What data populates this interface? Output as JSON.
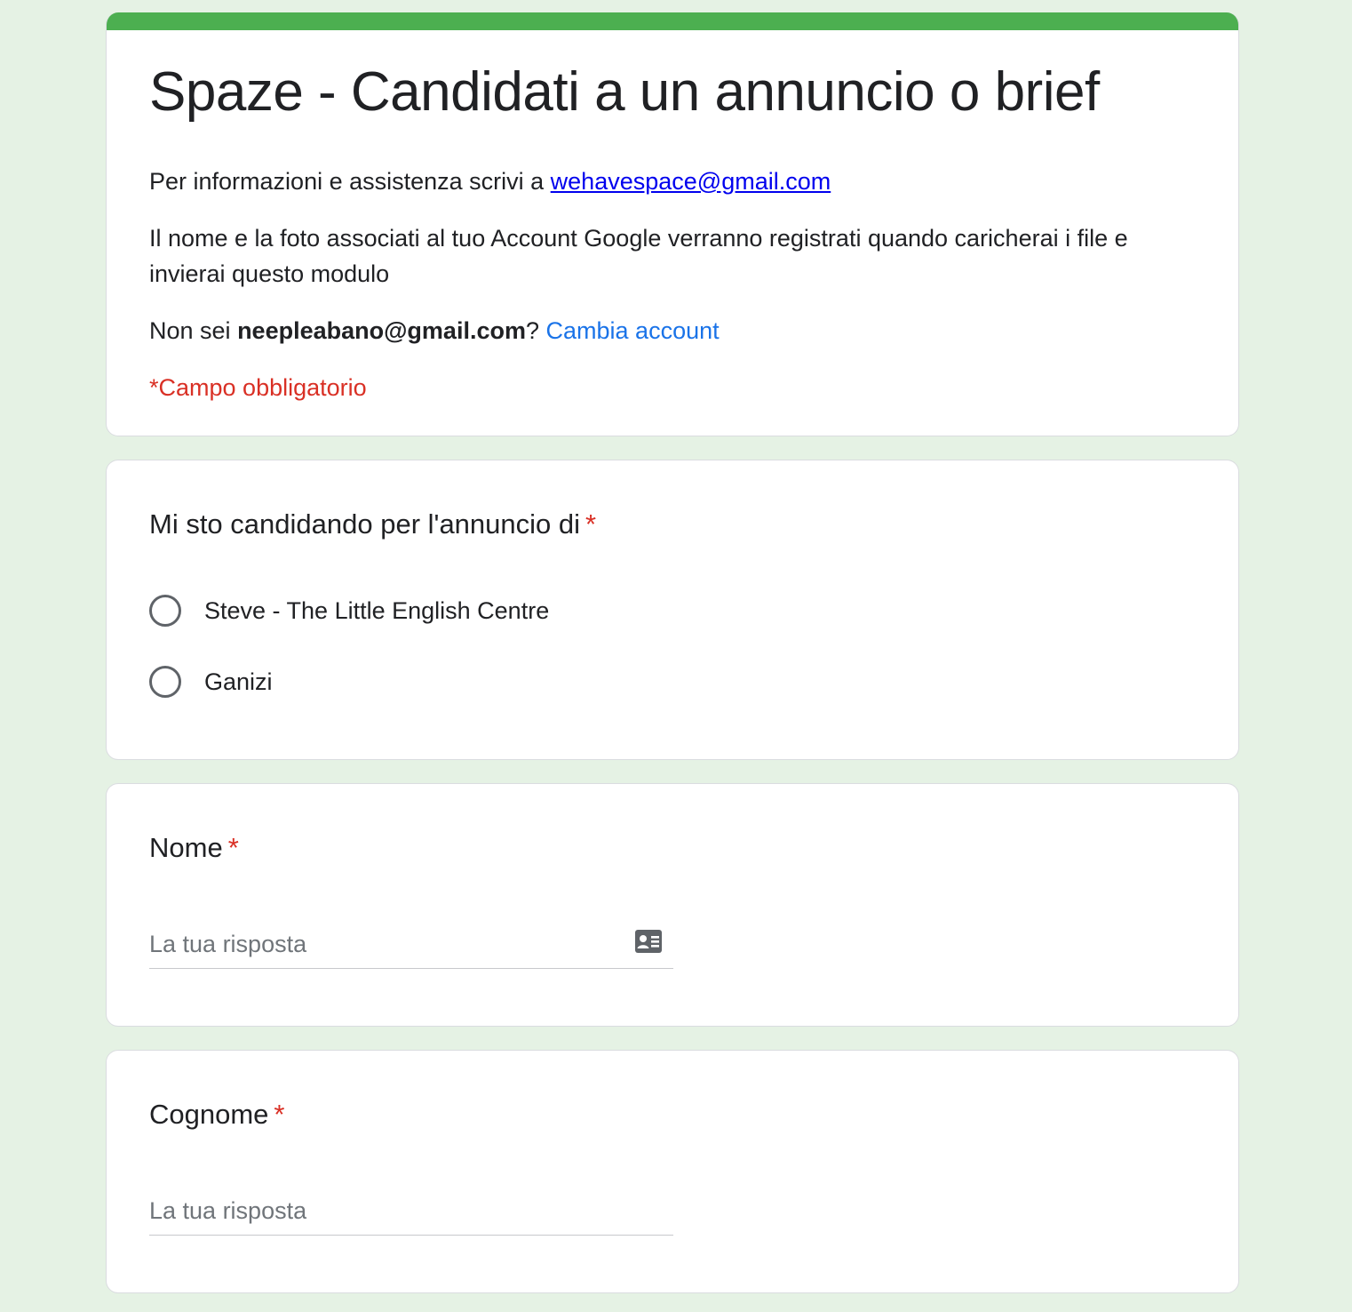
{
  "form": {
    "title": "Spaze - Candidati a un annuncio o brief",
    "info_prefix": "Per informazioni e assistenza scrivi a ",
    "info_email": "wehavespace@gmail.com",
    "account_notice": "Il nome e la foto associati al tuo Account Google verranno registrati quando caricherai i file e invierai questo modulo",
    "not_you_prefix": "Non sei ",
    "account_email": "neepleabano@gmail.com",
    "not_you_suffix": "? ",
    "switch_account": "Cambia account",
    "required_note": "*Campo obbligatorio"
  },
  "questions": [
    {
      "title": "Mi sto candidando per l'annuncio di",
      "required_mark": "*",
      "options": [
        "Steve - The Little English Centre",
        "Ganizi"
      ]
    },
    {
      "title": "Nome",
      "required_mark": "*",
      "placeholder": "La tua risposta",
      "icon": "contact-card-icon"
    },
    {
      "title": "Cognome",
      "required_mark": "*",
      "placeholder": "La tua risposta"
    }
  ],
  "colors": {
    "accent": "#4caf50",
    "background": "#e5f2e4",
    "required": "#d93025",
    "link": "#1a73e8"
  }
}
